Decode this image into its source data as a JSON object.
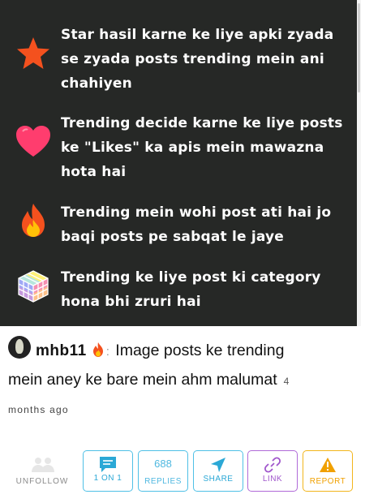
{
  "tips": [
    {
      "icon": "star-icon",
      "lines": [
        "Star hasil karne ke liye apki zyada",
        "se zyada posts trending mein ani",
        "chahiyen"
      ]
    },
    {
      "icon": "heart-icon",
      "lines": [
        "Trending decide karne ke liye posts",
        "ke \"Likes\" ka apis mein mawazna",
        "hota hai"
      ]
    },
    {
      "icon": "fire-icon",
      "lines": [
        "Trending mein wohi post ati hai jo",
        "baqi posts pe sabqat le jaye"
      ]
    },
    {
      "icon": "cube-icon",
      "lines": [
        "Trending ke liye post ki category",
        "hona bhi zruri hai"
      ]
    }
  ],
  "post": {
    "username": "mhb11",
    "separator": ":",
    "title_line1": "Image posts ke trending",
    "title_line2": "mein aney ke bare mein ahm malumat",
    "age_number": "4",
    "age_rest": "months ago"
  },
  "actions": {
    "unfollow": "UNFOLLOW",
    "one_on_one": "1 ON 1",
    "replies_count": "688",
    "replies": "REPLIES",
    "share": "SHARE",
    "link": "LINK",
    "report": "REPORT"
  },
  "colors": {
    "card_bg": "#262826",
    "accent_blue": "#4fc0e6",
    "link_purple": "#b06ad8",
    "report_yellow": "#f2b51c"
  }
}
